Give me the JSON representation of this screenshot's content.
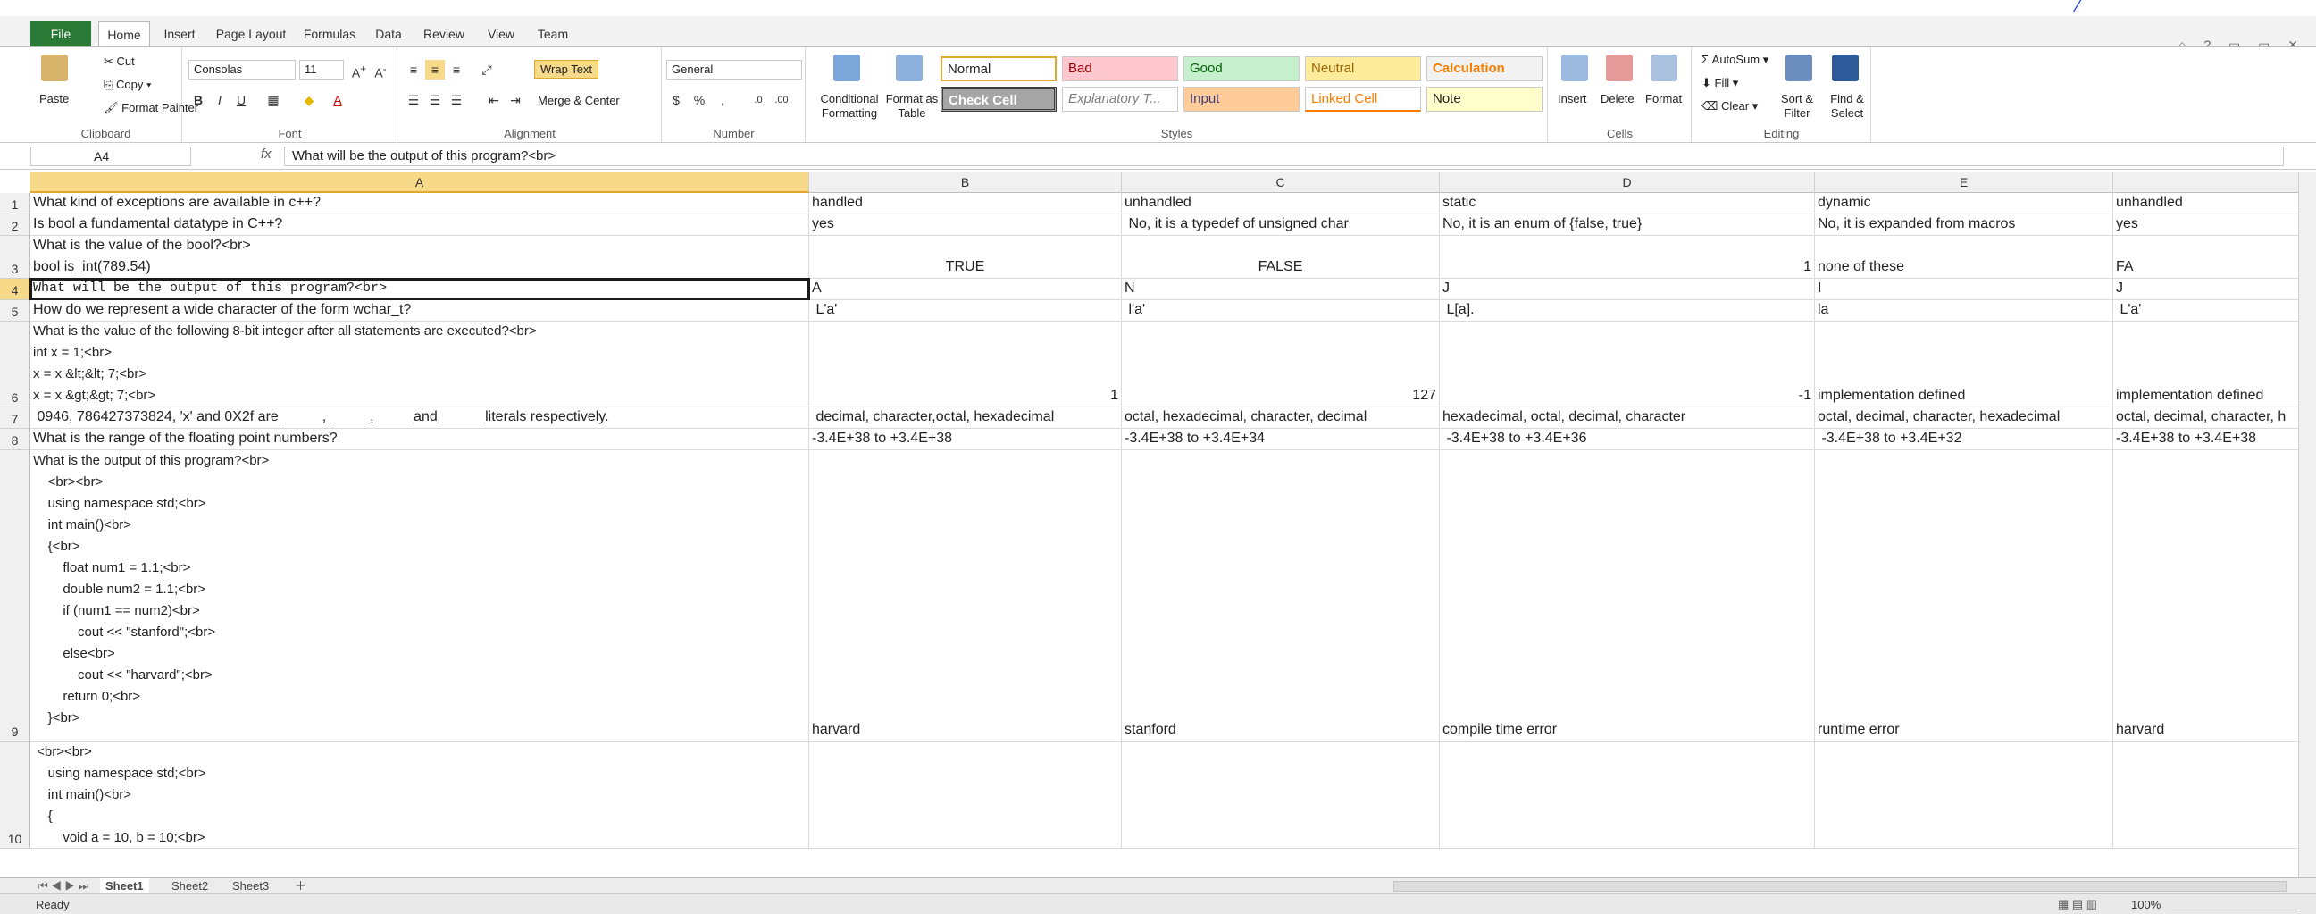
{
  "ribbon_tabs": [
    "File",
    "Home",
    "Insert",
    "Page Layout",
    "Formulas",
    "Data",
    "Review",
    "View",
    "Team"
  ],
  "clipboard": {
    "paste": "Paste",
    "cut": "Cut",
    "copy": "Copy",
    "format_painter": "Format Painter",
    "label": "Clipboard"
  },
  "font": {
    "name": "Consolas",
    "size": "11",
    "label": "Font"
  },
  "alignment": {
    "wrap_text": "Wrap Text",
    "merge_center": "Merge & Center",
    "label": "Alignment"
  },
  "number": {
    "format": "General",
    "label": "Number"
  },
  "styles": {
    "conditional": "Conditional Formatting",
    "format_table": "Format as Table",
    "normal": "Normal",
    "bad": "Bad",
    "good": "Good",
    "neutral": "Neutral",
    "calculation": "Calculation",
    "check_cell": "Check Cell",
    "explanatory": "Explanatory T...",
    "input": "Input",
    "linked_cell": "Linked Cell",
    "note": "Note",
    "label": "Styles"
  },
  "cells_group": {
    "insert": "Insert",
    "delete": "Delete",
    "format": "Format",
    "label": "Cells"
  },
  "editing": {
    "autosum": "AutoSum",
    "fill": "Fill",
    "clear": "Clear",
    "sort_filter": "Sort & Filter",
    "find_select": "Find & Select",
    "label": "Editing"
  },
  "formula_bar": {
    "name_box": "A4",
    "fx": "fx",
    "formula": "What will be the output of this program?<br>"
  },
  "columns": [
    "A",
    "B",
    "C",
    "D",
    "E"
  ],
  "colors": {
    "file_tab": "#2a7a35",
    "selection": "#f7d98a"
  },
  "rows": [
    {
      "num": "1",
      "cells": [
        "What kind of exceptions are available in c++?",
        "handled",
        "unhandled",
        "static",
        "dynamic",
        "unhandled"
      ]
    },
    {
      "num": "2",
      "cells": [
        "Is bool a fundamental datatype in C++?",
        "yes",
        " No, it is a typedef of unsigned char",
        "No, it is an enum of {false, true}",
        "No, it is expanded from macros",
        "yes"
      ]
    },
    {
      "num": "3",
      "cells": [
        "What is the value of the bool?<br>\nbool is_int(789.54)",
        "TRUE",
        "FALSE",
        "1",
        "none of these",
        "FA"
      ]
    },
    {
      "num": "4",
      "cells": [
        "What will be the output of this program?<br>\n    <br><br>",
        "A",
        "N",
        "J",
        "I",
        "J"
      ]
    },
    {
      "num": "5",
      "cells": [
        "How do we represent a wide character of the form wchar_t?",
        " L'a'",
        " l'a'",
        " L[a].",
        "la",
        " L'a'"
      ]
    },
    {
      "num": "6",
      "cells": [
        "What is the value of the following 8-bit integer after all statements are executed?<br>\nint x = 1;<br>\nx = x &lt;&lt; 7;<br>\nx = x &gt;&gt; 7;<br>",
        "1",
        "127",
        "-1",
        "implementation defined",
        "implementation defined"
      ]
    },
    {
      "num": "7",
      "cells": [
        " 0946, 786427373824, 'x' and 0X2f are _____, _____, ____ and _____ literals respectively.",
        " decimal, character,octal, hexadecimal",
        "octal, hexadecimal, character, decimal",
        "hexadecimal, octal, decimal, character",
        "octal, decimal, character, hexadecimal",
        "octal, decimal, character, h"
      ]
    },
    {
      "num": "8",
      "cells": [
        "What is the range of the floating point numbers?",
        "-3.4E+38 to +3.4E+38",
        "-3.4E+38 to +3.4E+34",
        " -3.4E+38 to +3.4E+36",
        " -3.4E+38 to +3.4E+32",
        "-3.4E+38 to +3.4E+38"
      ]
    },
    {
      "num": "9",
      "cells": [
        "What is the output of this program?<br>\n    <br><br>\n    using namespace std;<br>\n    int main()<br>\n    {<br>\n        float num1 = 1.1;<br>\n        double num2 = 1.1;<br>\n        if (num1 == num2)<br>\n            cout << \"stanford\";<br>\n        else<br>\n            cout << \"harvard\";<br>\n        return 0;<br>\n    }<br>",
        "harvard",
        "stanford",
        "compile time error",
        "runtime error",
        "harvard"
      ]
    },
    {
      "num": "10",
      "cells": [
        " <br><br>\n    using namespace std;<br>\n    int main()<br>\n    {\n        void a = 10, b = 10;<br>",
        "",
        "",
        "",
        "",
        ""
      ]
    }
  ],
  "sheets": [
    "Sheet1",
    "Sheet2",
    "Sheet3"
  ],
  "status": {
    "ready": "Ready",
    "zoom": "100%"
  }
}
